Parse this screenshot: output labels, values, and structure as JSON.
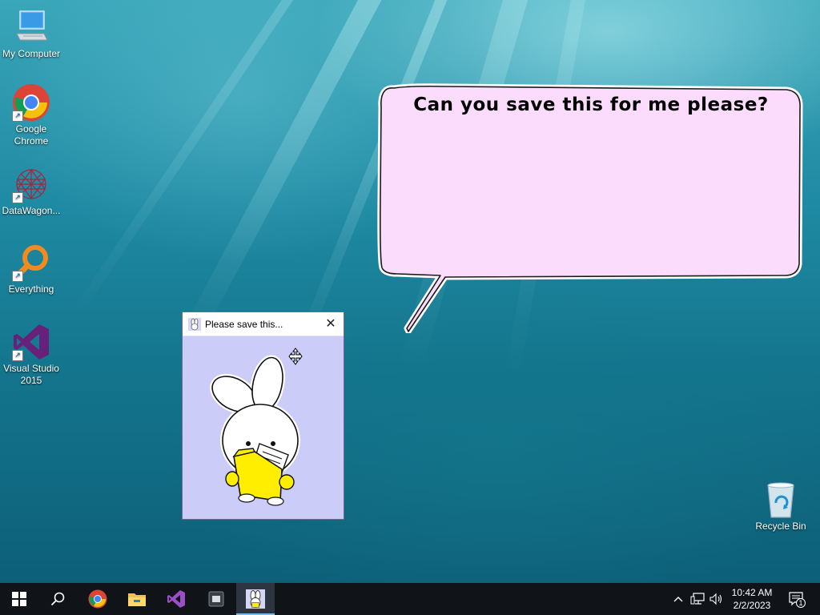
{
  "desktop_icons": [
    {
      "label": "My Computer"
    },
    {
      "label": "Google Chrome"
    },
    {
      "label": "DataWagon..."
    },
    {
      "label": "Everything"
    },
    {
      "label": "Visual Studio 2015"
    },
    {
      "label": "Recycle Bin"
    }
  ],
  "speech_bubble": {
    "text": "Can you save this for me please?"
  },
  "window": {
    "title": "Please save this..."
  },
  "taskbar": {
    "items": [
      "start-button",
      "search-icon",
      "chrome-icon",
      "file-explorer-icon",
      "visual-studio-icon",
      "app-icon",
      "bunny-app-icon"
    ],
    "active_item": "bunny-app-icon",
    "accent_color": "#76b9ed"
  },
  "clock": {
    "time": "10:42 AM",
    "date": "2/2/2023"
  },
  "notifications": {
    "count": "1"
  },
  "colors": {
    "bubble_fill": "#fcdcfc",
    "window_body": "#ccccf8",
    "folder": "#ffee00"
  }
}
